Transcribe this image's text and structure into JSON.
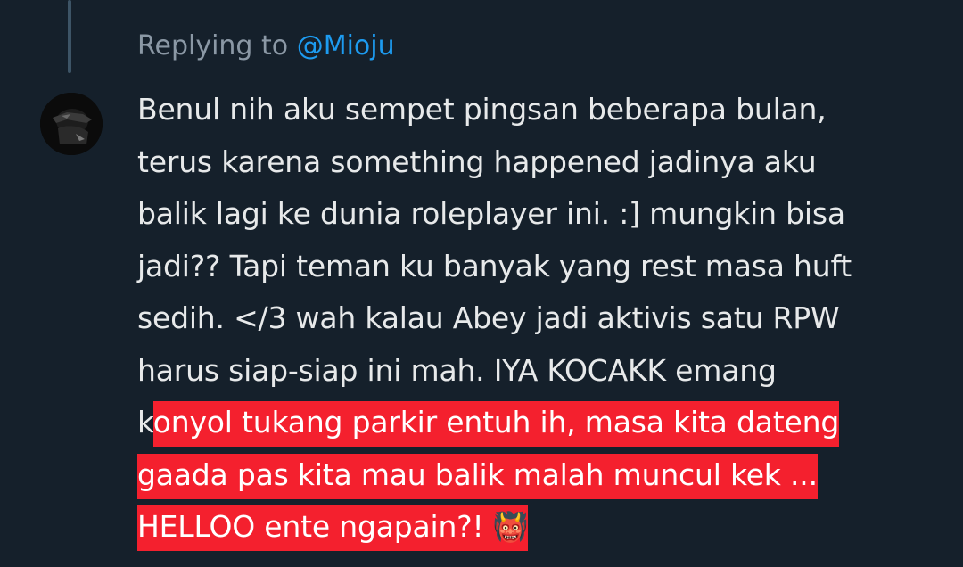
{
  "reply": {
    "prefix": "Replying to",
    "mention": "@Mioju"
  },
  "tweet": {
    "lines": [
      "Benul nih aku sempet pingsan beberapa bulan,",
      "terus karena something happened jadinya aku",
      "balik lagi ke dunia roleplayer ini. :] mungkin bisa",
      "jadi?? Tapi teman ku banyak yang rest masa huft",
      "sedih. </3 wah kalau Abey jadi aktivis satu RPW",
      "harus siap-siap ini mah. IYA KOCAKK emang"
    ],
    "line7_plain": "k",
    "line7_highlight": "onyol tukang parkir entuh ih, masa kita dateng",
    "line8_highlight": "gaada pas kita mau balik malah muncul kek ...",
    "line9_highlight": "HELLOO ente ngapain?! ",
    "emoji": "👹"
  },
  "colors": {
    "background": "#15202b",
    "text": "#e7e9ea",
    "muted": "#8b98a5",
    "mention": "#1d9bf0",
    "highlight": "#f4202e"
  },
  "icons": {
    "avatar": "user-avatar-dark-photo"
  }
}
